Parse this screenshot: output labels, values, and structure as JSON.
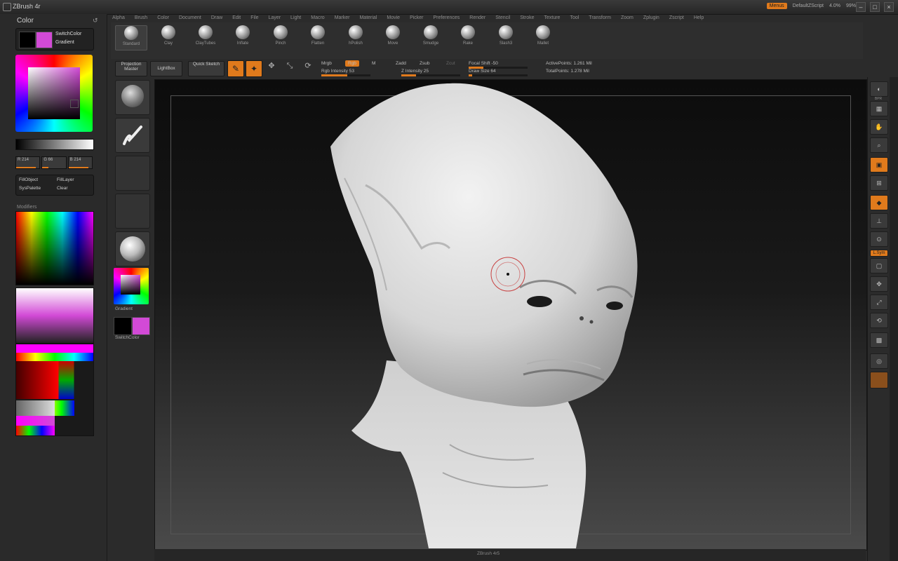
{
  "app": {
    "title": "ZBrush 4r",
    "badge": "Menus",
    "default_script": "DefaultZScript",
    "metrics": [
      "4.0%",
      "99%"
    ]
  },
  "menu": [
    "Alpha",
    "Brush",
    "Color",
    "Document",
    "Draw",
    "Edit",
    "File",
    "Layer",
    "Light",
    "Macro",
    "Marker",
    "Material",
    "Movie",
    "Picker",
    "Preferences",
    "Render",
    "Stencil",
    "Stroke",
    "Texture",
    "Tool",
    "Transform",
    "Zoom",
    "Zplugin",
    "Zscript",
    "Help"
  ],
  "left_panel": {
    "title": "Color",
    "switch_label": "SwitchColor",
    "gradient_label": "Gradient",
    "rgb": [
      "R 214",
      "G 66",
      "B 214"
    ],
    "fill_object": "FillObject",
    "fill_layer": "FillLayer",
    "sys_palette": "SysPalette",
    "clear": "Clear",
    "modifiers": "Modifiers"
  },
  "brushes": [
    "Standard",
    "Clay",
    "ClayTubes",
    "Inflate",
    "Pinch",
    "Flatten",
    "hPolish",
    "Move",
    "Smudge",
    "Rake",
    "Slash3",
    "Mallet"
  ],
  "toolbar2": {
    "projection_master": "Projection Master",
    "lightbox": "LightBox",
    "quick_sketch": "Quick Sketch",
    "buttons": [
      "Edit",
      "Draw",
      "Move",
      "Scale",
      "Rotate"
    ],
    "mrgb": "Mrgb",
    "rgb": "Rgb",
    "m": "M",
    "zadd": "Zadd",
    "zsub": "Zsub",
    "zcut": "Zcut",
    "rgb_intensity": "Rgb Intensity 53",
    "z_intensity": "Z Intensity 25",
    "focal_shift": "Focal Shift -50",
    "draw_size": "Draw Size 64",
    "active_points": "ActivePoints: 1.261 Mil",
    "total_points": "TotalPoints: 1.278 Mil"
  },
  "tool_col": {
    "gradient_label": "Gradient",
    "switch_label": "SwitchColor"
  },
  "right_shelf": [
    "BPR",
    "SPix",
    "Scroll",
    "Zoom",
    "Actual",
    "AAHalf",
    "Persp",
    "Floor",
    "Local",
    "L.Sym",
    "Frame",
    "Move",
    "Scale",
    "Rotate",
    "PolyF",
    "Transp",
    "Ghost",
    "Solo",
    "Xpose"
  ],
  "bottom_text": "ZBrush 4r5"
}
